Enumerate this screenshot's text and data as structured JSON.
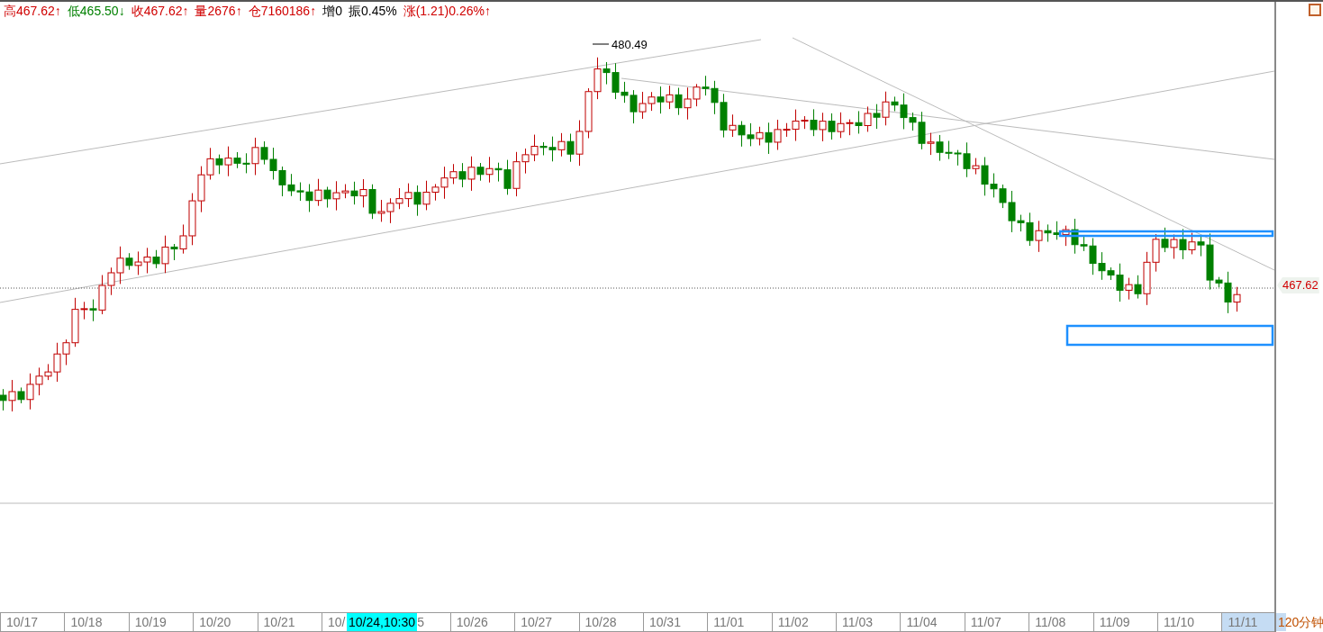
{
  "quote_bar": [
    {
      "text": "高467.62↑",
      "color": "#d00000"
    },
    {
      "text": "低465.50↓",
      "color": "#008000"
    },
    {
      "text": "收467.62↑",
      "color": "#d00000"
    },
    {
      "text": "量2676↑",
      "color": "#d00000"
    },
    {
      "text": "仓7160186↑",
      "color": "#d00000"
    },
    {
      "text": "增0",
      "color": "#000000"
    },
    {
      "text": "振0.45%",
      "color": "#000000"
    },
    {
      "text": "涨(1.21)0.26%↑",
      "color": "#d00000"
    }
  ],
  "chart": {
    "high_label": "480.49",
    "last_price_tag": "467.62"
  },
  "time_axis": [
    {
      "label": "10/17",
      "kind": "full",
      "highlighted": false
    },
    {
      "label": "10/18",
      "kind": "full",
      "highlighted": false
    },
    {
      "label": "10/19",
      "kind": "full",
      "highlighted": false
    },
    {
      "label": "10/20",
      "kind": "full",
      "highlighted": false
    },
    {
      "label": "10/21",
      "kind": "full",
      "highlighted": false
    },
    {
      "label": "10/",
      "kind": "full",
      "highlighted": false
    },
    {
      "label": "5",
      "kind": "tail",
      "highlighted": false
    },
    {
      "label": "10/26",
      "kind": "full",
      "highlighted": false
    },
    {
      "label": "10/27",
      "kind": "full",
      "highlighted": false
    },
    {
      "label": "10/28",
      "kind": "full",
      "highlighted": false
    },
    {
      "label": "10/31",
      "kind": "full",
      "highlighted": false
    },
    {
      "label": "11/01",
      "kind": "full",
      "highlighted": false
    },
    {
      "label": "11/02",
      "kind": "full",
      "highlighted": false
    },
    {
      "label": "11/03",
      "kind": "full",
      "highlighted": false
    },
    {
      "label": "11/04",
      "kind": "full",
      "highlighted": false
    },
    {
      "label": "11/07",
      "kind": "full",
      "highlighted": false
    },
    {
      "label": "11/08",
      "kind": "full",
      "highlighted": false
    },
    {
      "label": "11/09",
      "kind": "full",
      "highlighted": false
    },
    {
      "label": "11/10",
      "kind": "full",
      "highlighted": false
    },
    {
      "label": "11/11",
      "kind": "full",
      "highlighted": true
    }
  ],
  "cursor_time": "10/24,10:30",
  "period": "120分钟"
}
